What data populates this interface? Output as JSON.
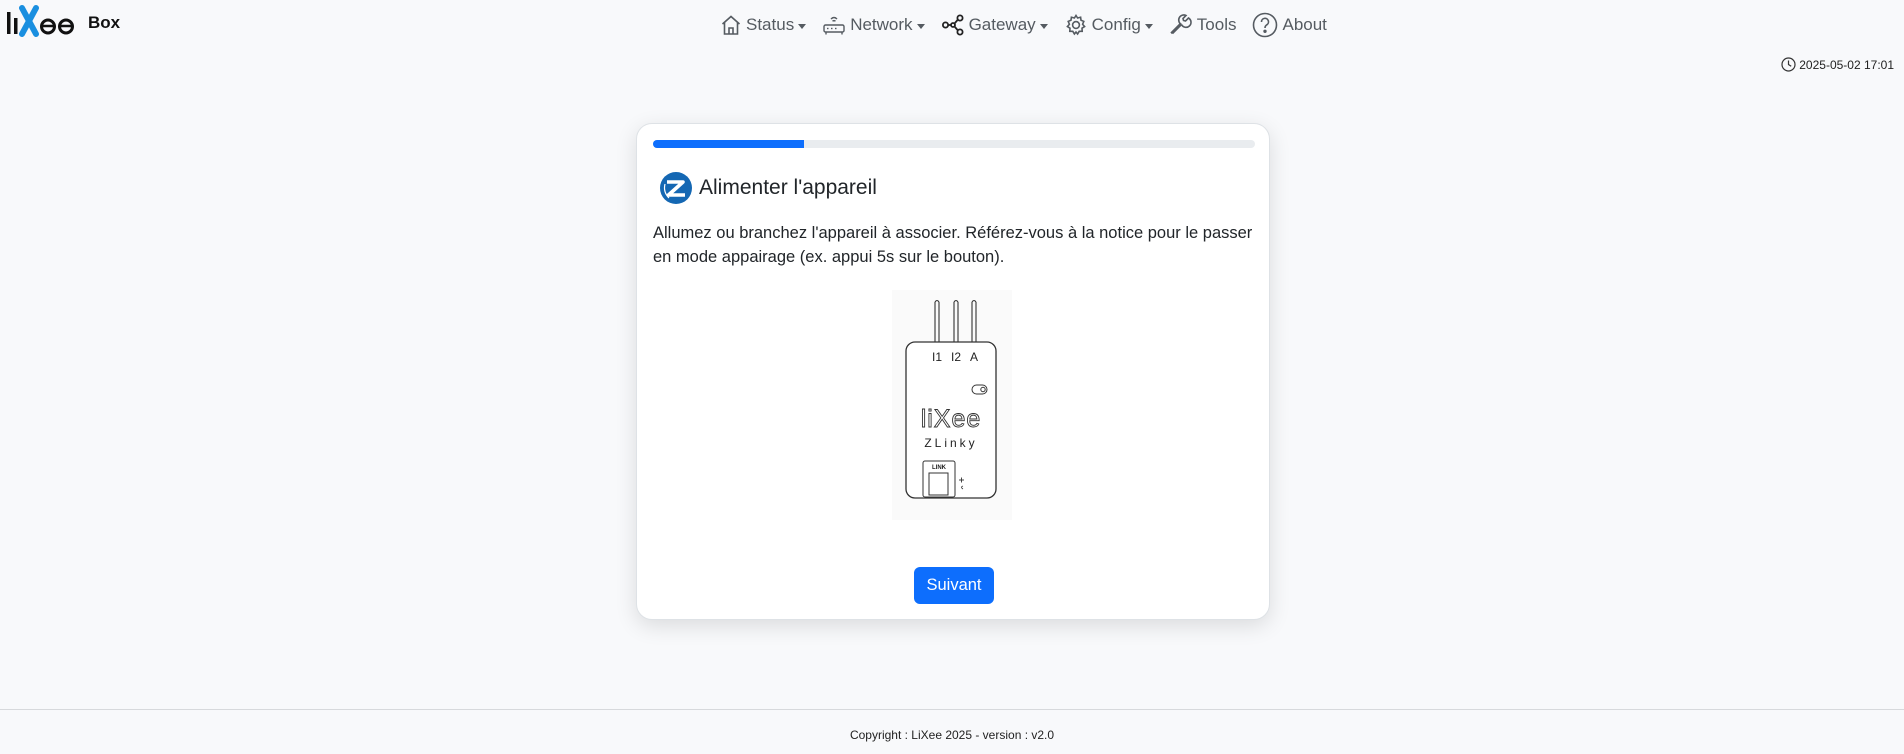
{
  "brand": {
    "logo_text": "liXee",
    "suffix": "Box"
  },
  "nav": {
    "items": [
      {
        "label": "Status",
        "icon": "home-icon",
        "dropdown": true
      },
      {
        "label": "Network",
        "icon": "router-icon",
        "dropdown": true
      },
      {
        "label": "Gateway",
        "icon": "share-icon",
        "dropdown": true
      },
      {
        "label": "Config",
        "icon": "gear-icon",
        "dropdown": true
      },
      {
        "label": "Tools",
        "icon": "wrench-icon",
        "dropdown": false
      },
      {
        "label": "About",
        "icon": "question-icon",
        "dropdown": false
      }
    ]
  },
  "datetime": "2025-05-02 17:01",
  "wizard": {
    "progress_percent": 25,
    "title": "Alimenter l'appareil",
    "description": "Allumez ou branchez l'appareil à associer. Référez-vous à la notice pour le passer en mode appairage (ex. appui 5s sur le bouton).",
    "next_label": "Suivant",
    "device": {
      "terminal_labels": [
        "I1",
        "I2",
        "A"
      ],
      "brand": "liXee",
      "model": "ZLinky",
      "link_label": "LINK"
    }
  },
  "footer": {
    "copyright": "Copyright : LiXee 2025 - version : v2.0"
  },
  "colors": {
    "accent": "#0d6efd",
    "zigbee": "#1467b3",
    "logo_x": "#1a8fe0"
  }
}
